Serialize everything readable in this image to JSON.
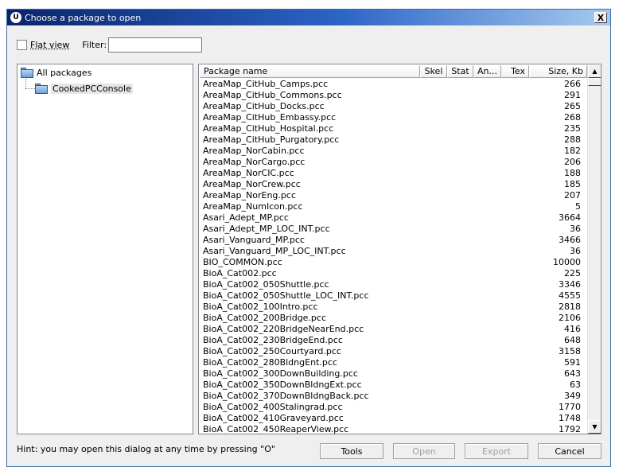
{
  "window": {
    "title": "Choose a package to open",
    "close_glyph": "X",
    "app_icon_glyph": "U"
  },
  "toolbar": {
    "flat_view_label": "Flat view",
    "flat_view_checked": false,
    "filter_label": "Filter:",
    "filter_value": ""
  },
  "tree": {
    "root_label": "All packages",
    "child_label": "CookedPCConsole"
  },
  "columns": [
    "Package name",
    "Skel",
    "Stat",
    "An...",
    "Tex",
    "Size, Kb"
  ],
  "rows": [
    {
      "name": "AreaMap_CitHub_Camps.pcc",
      "size": "266"
    },
    {
      "name": "AreaMap_CitHub_Commons.pcc",
      "size": "291"
    },
    {
      "name": "AreaMap_CitHub_Docks.pcc",
      "size": "265"
    },
    {
      "name": "AreaMap_CitHub_Embassy.pcc",
      "size": "268"
    },
    {
      "name": "AreaMap_CitHub_Hospital.pcc",
      "size": "235"
    },
    {
      "name": "AreaMap_CitHub_Purgatory.pcc",
      "size": "288"
    },
    {
      "name": "AreaMap_NorCabin.pcc",
      "size": "182"
    },
    {
      "name": "AreaMap_NorCargo.pcc",
      "size": "206"
    },
    {
      "name": "AreaMap_NorCIC.pcc",
      "size": "188"
    },
    {
      "name": "AreaMap_NorCrew.pcc",
      "size": "185"
    },
    {
      "name": "AreaMap_NorEng.pcc",
      "size": "207"
    },
    {
      "name": "AreaMap_NumIcon.pcc",
      "size": "5"
    },
    {
      "name": "Asari_Adept_MP.pcc",
      "size": "3664"
    },
    {
      "name": "Asari_Adept_MP_LOC_INT.pcc",
      "size": "36"
    },
    {
      "name": "Asari_Vanguard_MP.pcc",
      "size": "3466"
    },
    {
      "name": "Asari_Vanguard_MP_LOC_INT.pcc",
      "size": "36"
    },
    {
      "name": "BIO_COMMON.pcc",
      "size": "10000"
    },
    {
      "name": "BioA_Cat002.pcc",
      "size": "225"
    },
    {
      "name": "BioA_Cat002_050Shuttle.pcc",
      "size": "3346"
    },
    {
      "name": "BioA_Cat002_050Shuttle_LOC_INT.pcc",
      "size": "4555"
    },
    {
      "name": "BioA_Cat002_100Intro.pcc",
      "size": "2818"
    },
    {
      "name": "BioA_Cat002_200Bridge.pcc",
      "size": "2106"
    },
    {
      "name": "BioA_Cat002_220BridgeNearEnd.pcc",
      "size": "416"
    },
    {
      "name": "BioA_Cat002_230BridgeEnd.pcc",
      "size": "648"
    },
    {
      "name": "BioA_Cat002_250Courtyard.pcc",
      "size": "3158"
    },
    {
      "name": "BioA_Cat002_280BldngEnt.pcc",
      "size": "591"
    },
    {
      "name": "BioA_Cat002_300DownBuilding.pcc",
      "size": "643"
    },
    {
      "name": "BioA_Cat002_350DownBldngExt.pcc",
      "size": "63"
    },
    {
      "name": "BioA_Cat002_370DownBldngBack.pcc",
      "size": "349"
    },
    {
      "name": "BioA_Cat002_400Stalingrad.pcc",
      "size": "1770"
    },
    {
      "name": "BioA_Cat002_410Graveyard.pcc",
      "size": "1748"
    },
    {
      "name": "BioA_Cat002_450ReaperView.pcc",
      "size": "1792"
    }
  ],
  "hint": "Hint: you may open this dialog at any time by pressing \"O\"",
  "buttons": {
    "tools": "Tools",
    "open": "Open",
    "export": "Export",
    "cancel": "Cancel"
  }
}
